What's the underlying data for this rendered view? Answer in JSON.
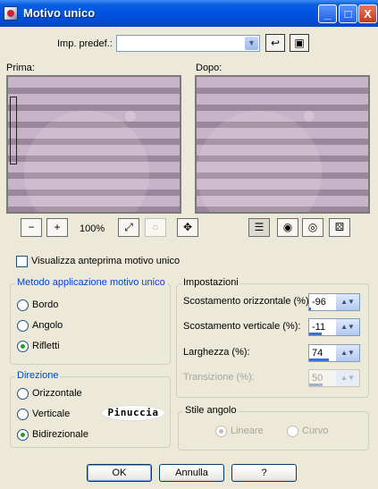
{
  "window": {
    "title": "Motivo unico",
    "minimize": "_",
    "maximize": "□",
    "close": "X"
  },
  "preset": {
    "label": "Imp. predef.:",
    "value": "",
    "dropdown_icon": "chevron-down-icon",
    "reset_icon": "reset-arrow-icon",
    "save_icon": "floppy-disk-icon"
  },
  "previews": {
    "before_label": "Prima:",
    "after_label": "Dopo:"
  },
  "toolbar": {
    "zoom_out_icon": "zoom-out-icon",
    "zoom_in_icon": "zoom-in-icon",
    "zoom_level": "100%",
    "fit_icon": "fit-window-icon",
    "zoom_disabled_icon": "zoom-disabled-icon",
    "pan_icon": "move-cross-icon",
    "list_icon": "list-icon",
    "proof_icon": "proof-eye-icon",
    "auto_proof_icon": "auto-proof-eye-icon",
    "randomize_icon": "dice-icon"
  },
  "preview_checkbox": {
    "label": "Visualizza anteprima motivo unico",
    "checked": false
  },
  "method": {
    "title": "Metodo applicazione motivo unico",
    "options": [
      "Bordo",
      "Angolo",
      "Rifletti"
    ],
    "selected": "Rifletti"
  },
  "direction": {
    "title": "Direzione",
    "options": [
      "Orizzontale",
      "Verticale",
      "Bidirezionale"
    ],
    "selected": "Bidirezionale"
  },
  "settings": {
    "title": "Impostazioni",
    "fields": [
      {
        "label": "Scostamento orizzontale (%):",
        "value": "-96",
        "level": 0.02,
        "enabled": true
      },
      {
        "label": "Scostamento verticale (%):",
        "value": "-11",
        "level": 0.45,
        "enabled": true
      },
      {
        "label": "Larghezza (%):",
        "value": "74",
        "level": 0.74,
        "enabled": true
      },
      {
        "label": "Transizione (%):",
        "value": "50",
        "level": 0.5,
        "enabled": false
      }
    ]
  },
  "corner_style": {
    "title": "Stile angolo",
    "options": [
      "Lineare",
      "Curvo"
    ],
    "selected": "Lineare",
    "enabled": false
  },
  "watermark": "Pinuccia",
  "buttons": {
    "ok": "OK",
    "cancel": "Annulla",
    "help": "?"
  },
  "colors": {
    "titlebar": "#0054e3",
    "dialog_bg": "#ece9d8",
    "group_title": "#0046d5",
    "stripe_light": "#c8b4c8",
    "stripe_dark": "#9b879b"
  }
}
